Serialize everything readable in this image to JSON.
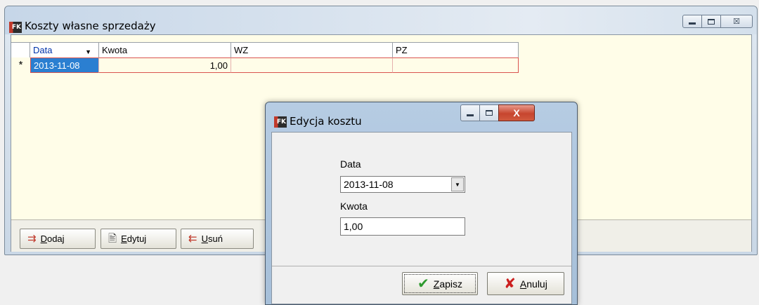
{
  "main_window": {
    "title": "Koszty własne sprzedaży",
    "icon": "fk-app-icon",
    "caption_buttons": [
      "minimize-icon",
      "maximize-icon",
      "close-icon"
    ],
    "close_glyph": "☒"
  },
  "grid": {
    "columns": [
      "Data",
      "Kwota",
      "WZ",
      "PZ"
    ],
    "sort_indicator": "▼",
    "rows": [
      {
        "marker": "*",
        "data": "2013-11-08",
        "kwota": "1,00",
        "wz": "",
        "pz": ""
      }
    ]
  },
  "toolbar": {
    "add_label": "Dodaj",
    "edit_label": "Edytuj",
    "delete_label": "Usuń",
    "add_icon": "add-row-icon",
    "edit_icon": "edit-document-icon",
    "delete_icon": "delete-row-icon"
  },
  "dialog": {
    "title": "Edycja kosztu",
    "icon": "fk-app-icon",
    "date_label": "Data",
    "date_value": "2013-11-08",
    "amount_label": "Kwota",
    "amount_value": "1,00",
    "save_label": "Zapisz",
    "cancel_label": "Anuluj",
    "close_glyph": "X"
  },
  "colors": {
    "selection": "#2b7fd1",
    "row_border": "#d9534f",
    "client_background": "#fffde8"
  }
}
